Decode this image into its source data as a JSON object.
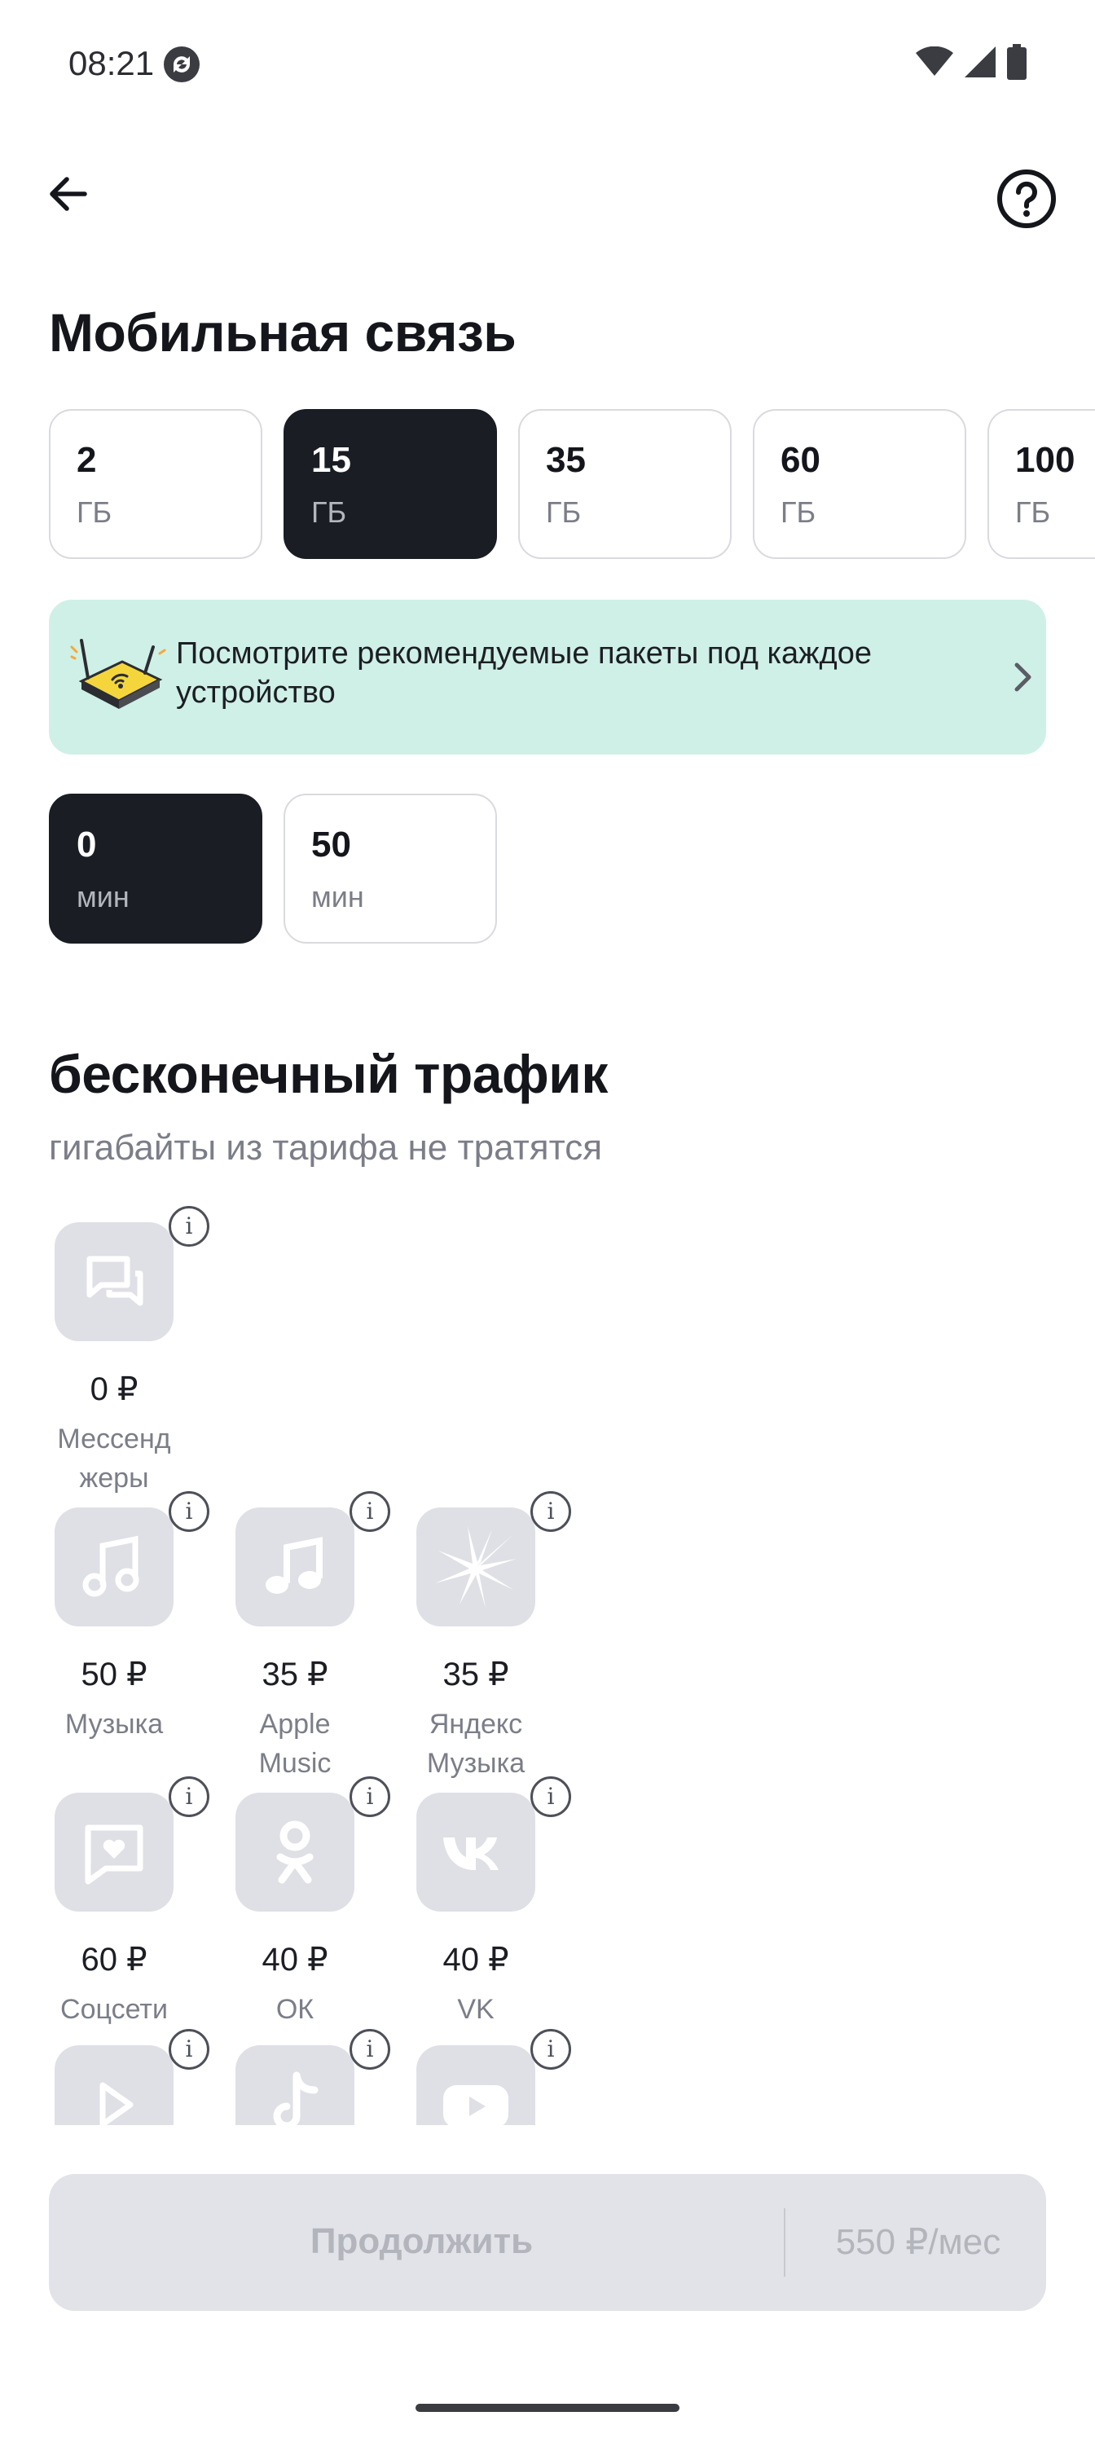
{
  "status_bar": {
    "time": "08:21"
  },
  "title": "Мобильная связь",
  "data_packages": [
    {
      "value": "2",
      "unit": "ГБ",
      "selected": false
    },
    {
      "value": "15",
      "unit": "ГБ",
      "selected": true
    },
    {
      "value": "35",
      "unit": "ГБ",
      "selected": false
    },
    {
      "value": "60",
      "unit": "ГБ",
      "selected": false
    },
    {
      "value": "100",
      "unit": "ГБ",
      "selected": false
    }
  ],
  "banner": {
    "text": "Посмотрите рекомендуемые пакеты под каждое устройство"
  },
  "minutes": [
    {
      "value": "0",
      "unit": "мин",
      "selected": true
    },
    {
      "value": "50",
      "unit": "мин",
      "selected": false
    }
  ],
  "unlimited": {
    "title": "бесконечный трафик",
    "subtitle": "гигабайты из тарифа не тратятся",
    "services": [
      {
        "icon": "messenger-icon",
        "price": "0 ₽",
        "name": "Мессенд\nжеры"
      },
      {
        "icon": "music-note-icon",
        "price": "50 ₽",
        "name": "Музыка"
      },
      {
        "icon": "apple-music-icon",
        "price": "35 ₽",
        "name": "Apple\nMusic"
      },
      {
        "icon": "yandex-music-icon",
        "price": "35 ₽",
        "name": "Яндекс\nМузыка"
      },
      {
        "icon": "social-chat-heart-icon",
        "price": "60 ₽",
        "name": "Соцсети"
      },
      {
        "icon": "ok-icon",
        "price": "40 ₽",
        "name": "ОК"
      },
      {
        "icon": "vk-icon",
        "price": "40 ₽",
        "name": "VK"
      },
      {
        "icon": "video-play-icon",
        "price": "",
        "name": ""
      },
      {
        "icon": "tiktok-icon",
        "price": "",
        "name": ""
      },
      {
        "icon": "youtube-icon",
        "price": "",
        "name": ""
      }
    ]
  },
  "cta": {
    "label": "Продолжить",
    "price": "550 ₽/мес"
  },
  "colors": {
    "accent_dark": "#1b1d24",
    "banner_bg": "#cff0e6",
    "tile_bg": "#dfe0e5"
  }
}
